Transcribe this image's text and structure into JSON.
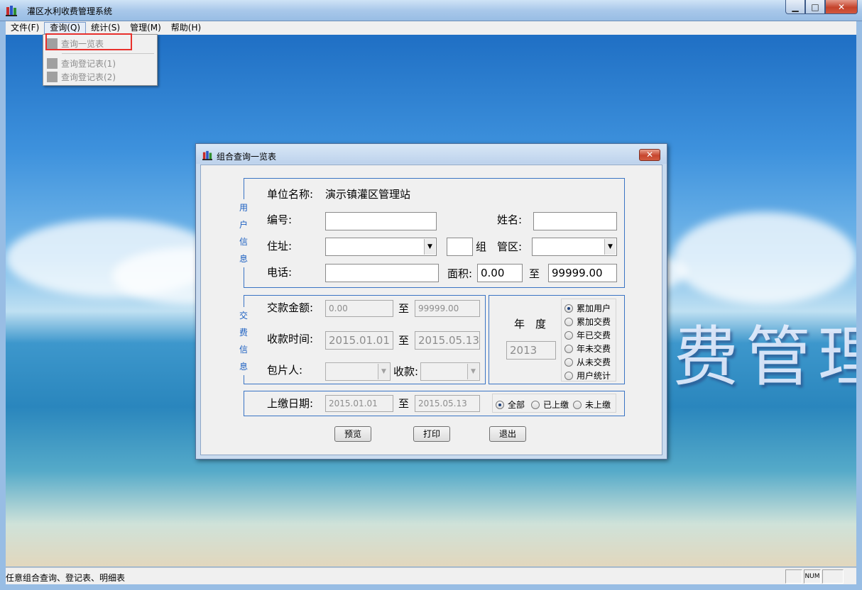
{
  "window": {
    "title": "灌区水利收费管理系统",
    "buttons": {
      "minimize": "▁",
      "maximize": "□",
      "close": "✕"
    }
  },
  "menubar": {
    "items": [
      {
        "label": "文件(F)"
      },
      {
        "label": "查询(Q)"
      },
      {
        "label": "统计(S)"
      },
      {
        "label": "管理(M)"
      },
      {
        "label": "帮助(H)"
      }
    ]
  },
  "dropdown": {
    "items": [
      {
        "label": "查询一览表"
      },
      {
        "label": "查询登记表(1)"
      },
      {
        "label": "查询登记表(2)"
      }
    ]
  },
  "background": {
    "text": "费管理"
  },
  "dialog": {
    "title": "组合查询一览表",
    "close": "✕",
    "user_info": {
      "group_label": [
        "用",
        "户",
        "信",
        "息"
      ],
      "unit_name_label": "单位名称:",
      "unit_name_value": "演示镇灌区管理站",
      "id_label": "编号:",
      "id_value": "",
      "name_label": "姓名:",
      "name_value": "",
      "address_label": "住址:",
      "address_value": "",
      "group_num_value": "",
      "group_suffix": "组",
      "district_label": "管区:",
      "district_value": "",
      "phone_label": "电话:",
      "phone_value": "",
      "area_label": "面积:",
      "area_from": "0.00",
      "area_to_label": "至",
      "area_to": "99999.00"
    },
    "payment_info": {
      "group_label": [
        "交",
        "费",
        "信",
        "息"
      ],
      "amount_label": "交款金额:",
      "amount_from": "0.00",
      "amount_to_label": "至",
      "amount_to": "99999.00",
      "time_label": "收款时间:",
      "time_from": "2015.01.01",
      "time_to_label": "至",
      "time_to": "2015.05.13",
      "collector_label": "包片人:",
      "collector_value": "",
      "payee_label": "收款:",
      "payee_value": ""
    },
    "year": {
      "label": "年　度",
      "value": "2013",
      "options": [
        {
          "label": "累加用户",
          "selected": true
        },
        {
          "label": "累加交费",
          "selected": false
        },
        {
          "label": "年已交费",
          "selected": false
        },
        {
          "label": "年未交费",
          "selected": false
        },
        {
          "label": "从未交费",
          "selected": false
        },
        {
          "label": "用户统计",
          "selected": false
        }
      ]
    },
    "submit_date": {
      "label": "上缴日期:",
      "from": "2015.01.01",
      "to_label": "至",
      "to": "2015.05.13",
      "options": [
        {
          "label": "全部",
          "selected": true
        },
        {
          "label": "已上缴",
          "selected": false
        },
        {
          "label": "未上缴",
          "selected": false
        }
      ]
    },
    "buttons": {
      "preview": "预览",
      "print": "打印",
      "exit": "退出"
    }
  },
  "statusbar": {
    "text": "任意组合查询、登记表、明细表",
    "num": "NUM"
  }
}
